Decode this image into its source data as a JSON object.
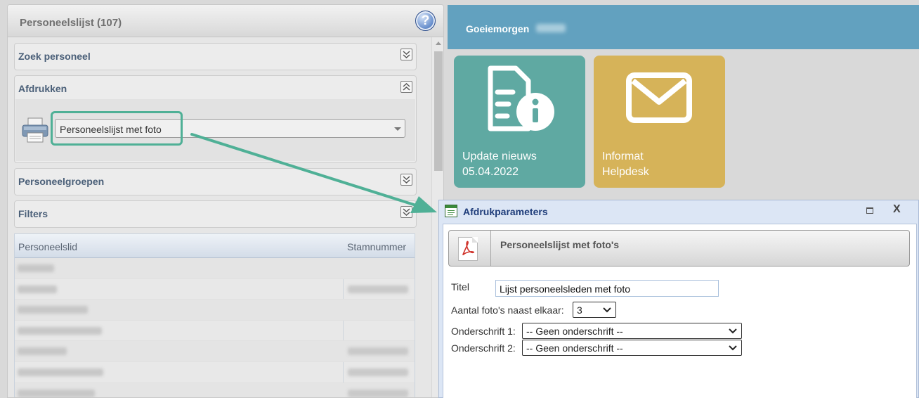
{
  "left_panel": {
    "title": "Personeelslijst (107)",
    "help_label": "?",
    "sections": {
      "zoek": "Zoek personeel",
      "afdrukken": "Afdrukken",
      "groepen": "Personeelgroepen",
      "filters": "Filters"
    },
    "print_select_value": "Personeelslijst met foto",
    "table": {
      "columns": [
        "Personeelslid",
        "Stamnummer"
      ]
    }
  },
  "banner": {
    "greeting": "Goeiemorgen"
  },
  "tiles": [
    {
      "line1": "Update nieuws",
      "line2": "05.04.2022",
      "icon": "document-info-icon",
      "color": "#5fa9a2"
    },
    {
      "line1": "Informat",
      "line2": "Helpdesk",
      "icon": "envelope-icon",
      "color": "#d6b359"
    }
  ],
  "dialog": {
    "title": "Afdrukparameters",
    "close_label": "X",
    "report_title": "Personeelslijst met foto's",
    "fields": {
      "titel_label": "Titel",
      "titel_value": "Lijst personeelsleden met foto",
      "aantal_label": "Aantal foto's naast elkaar:",
      "aantal_value": "3",
      "onderschrift1_label": "Onderschrift 1:",
      "onderschrift1_value": "-- Geen onderschrift --",
      "onderschrift2_label": "Onderschrift 2:",
      "onderschrift2_value": "-- Geen onderschrift --"
    }
  },
  "colors": {
    "highlight": "#4fb096",
    "banner": "#62a1bf",
    "dialog_title": "#1f3d7a"
  }
}
